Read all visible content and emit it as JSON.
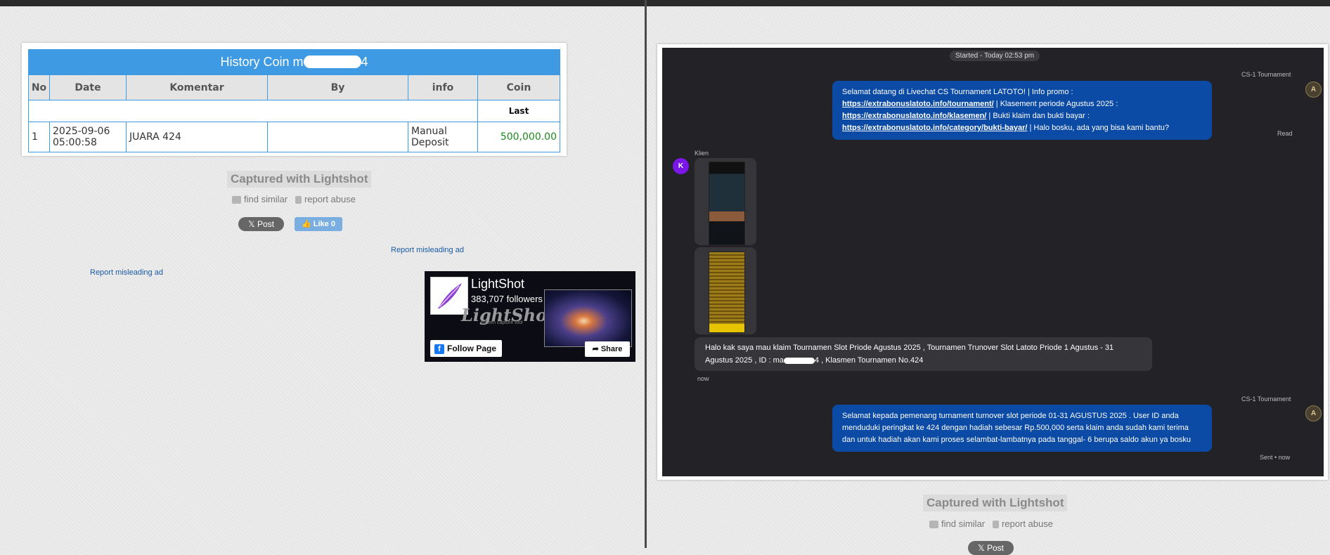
{
  "left": {
    "history_title_prefix": "History Coin m",
    "history_title_suffix": "4",
    "table": {
      "headers": [
        "No",
        "Date",
        "Komentar",
        "By",
        "info",
        "Coin"
      ],
      "last_label": "Last",
      "rows": [
        {
          "no": "1",
          "date_line1": "2025-09-06",
          "date_line2": "05:00:58",
          "komentar": "JUARA 424",
          "by": "",
          "info_line1": "Manual",
          "info_line2": "Deposit",
          "coin": "500,000.00"
        }
      ]
    },
    "captured": "Captured with Lightshot",
    "find_similar": "find similar",
    "report_abuse": "report abuse",
    "post": "Post",
    "like": "Like 0",
    "report_ad_1": "Report misleading ad",
    "report_ad_2": "Report misleading ad",
    "fb": {
      "name": "LightShot",
      "followers": "383,707 followers",
      "wordmark": "LightShot",
      "subtitle": "screen capture tool",
      "follow": "Follow Page",
      "share": "Share"
    }
  },
  "right": {
    "started": "Started - Today 02:53 pm",
    "agent_name_1": "CS-1 Tournament",
    "msg1_a": "Selamat datang di Livechat CS Tournament LATOTO! | Info promo : ",
    "msg1_link1": "https://extrabonuslatoto.info/tournament/",
    "msg1_b": " | Klasement periode Agustus 2025 : ",
    "msg1_link2": "https://extrabonuslatoto.info/klasemen/",
    "msg1_c": " | Bukti klaim dan bukti bayar : ",
    "msg1_link3": "https://extrabonuslatoto.info/category/bukti-bayar/",
    "msg1_d": " | Halo bosku, ada yang bisa kami bantu?",
    "read": "Read",
    "client_name": "Klien",
    "client_initial": "K",
    "msg2_a": "Halo kak saya mau klaim Tournamen Slot Priode Agustus 2025 , Tournamen Trunover Slot Latoto Priode 1 Agustus - 31 Agustus 2025 , ID : ma",
    "msg2_b": "4 , Klasmen Tournamen No.424",
    "now": "now",
    "agent_name_2": "CS-1 Tournament",
    "msg3": "Selamat kepada pemenang turnament turnover slot periode 01-31 AGUSTUS 2025 . User ID anda menduduki peringkat ke 424 dengan hadiah sebesar Rp.500,000 serta klaim anda sudah kami terima dan untuk hadiah akan kami proses selambat-lambatnya pada tanggal- 6 berupa saldo akun ya bosku",
    "sent": "Sent • now",
    "captured": "Captured with Lightshot",
    "find_similar": "find similar",
    "report_abuse": "report abuse",
    "post": "Post"
  }
}
